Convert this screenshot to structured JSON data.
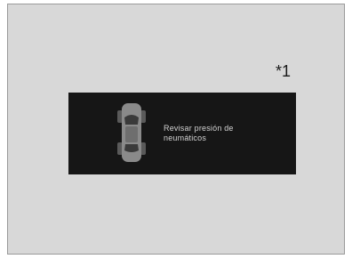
{
  "footnote": "*1",
  "warning": {
    "icon": "car-top-view-icon",
    "line1": "Revisar presión de",
    "line2": "neumáticos"
  },
  "colors": {
    "background": "#d8d8d8",
    "panel": "#161616",
    "text": "#d2d2d2"
  }
}
